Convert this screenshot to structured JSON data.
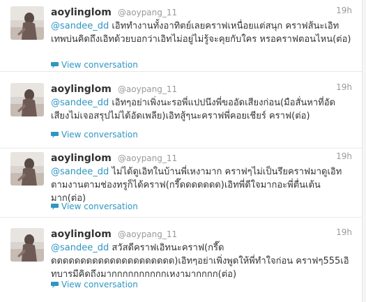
{
  "colors": {
    "link": "#2f96c1",
    "name": "#333333",
    "meta": "#999999",
    "divider": "#e8e8e8"
  },
  "tweets": [
    {
      "name": "aoylinglom",
      "handle": "@aoypang_11",
      "time": "19h",
      "mention": "@sandee_dd",
      "text": " เอิททำงานทั้งอาทิตย์เลยคราฟเหนื่อยแต่สนุก คราฟส้นะเอิท เทพบ่นคิดถึงเอิทด้วยบอกว่าเอิทไม่อยู่ไม่รู้จะคุยกับใคร หรอคราฟตอนไหน(ต่อ)",
      "action": "View conversation",
      "action_icon": "speech-bubble-icon"
    },
    {
      "name": "aoylinglom",
      "handle": "@aoypang_11",
      "time": "19h",
      "mention": "@sandee_dd",
      "text": " เอิทๆอย่าเพิ่งนะรอพี่แปปนึงพี่ขออัดเสียงก่อน(มือสั่นหาที่อัดเสียงไม่เจอสรุปไม่ได้อัดเพลีย)เอิทสู้ๆนะคราฟพี่คอยเชียร์ คราฟ(ต่อ)",
      "action": "View conversation",
      "action_icon": "speech-bubble-icon"
    },
    {
      "name": "aoylinglom",
      "handle": "@aoypang_11",
      "time": "19h",
      "mention": "@sandee_dd",
      "text": " ไม่ได้ดูเอิทในบ้านพี่เหงามาก คราฟๆไม่เป็นรึยคราฟมาดูเอิทตามงานตามช่องทรูก็ได้คราฟ(กรี๊ดดดดดดด)เอิทพี่ดีใจมากอะพี่ตื่นเต้นมาก(ต่อ)",
      "action": "View conversation",
      "action_icon": "speech-bubble-icon"
    },
    {
      "name": "aoylinglom",
      "handle": "@aoypang_11",
      "time": "19h",
      "mention": "@sandee_dd",
      "text": " สวัสดีคราฟเอิทนะคราฟ(กรี๊ดดดดดดดดดดดดดดดดดดดดดด)เอิทๆอย่าเพิ่งพูดให้พี่ทำใจก่อน คราฟๆ555เอิทบารมีคิดถึงมากกกกกกกกกกเหงามากกกก(ต่อ)",
      "action": "View conversation",
      "action_icon": "speech-bubble-icon"
    }
  ]
}
